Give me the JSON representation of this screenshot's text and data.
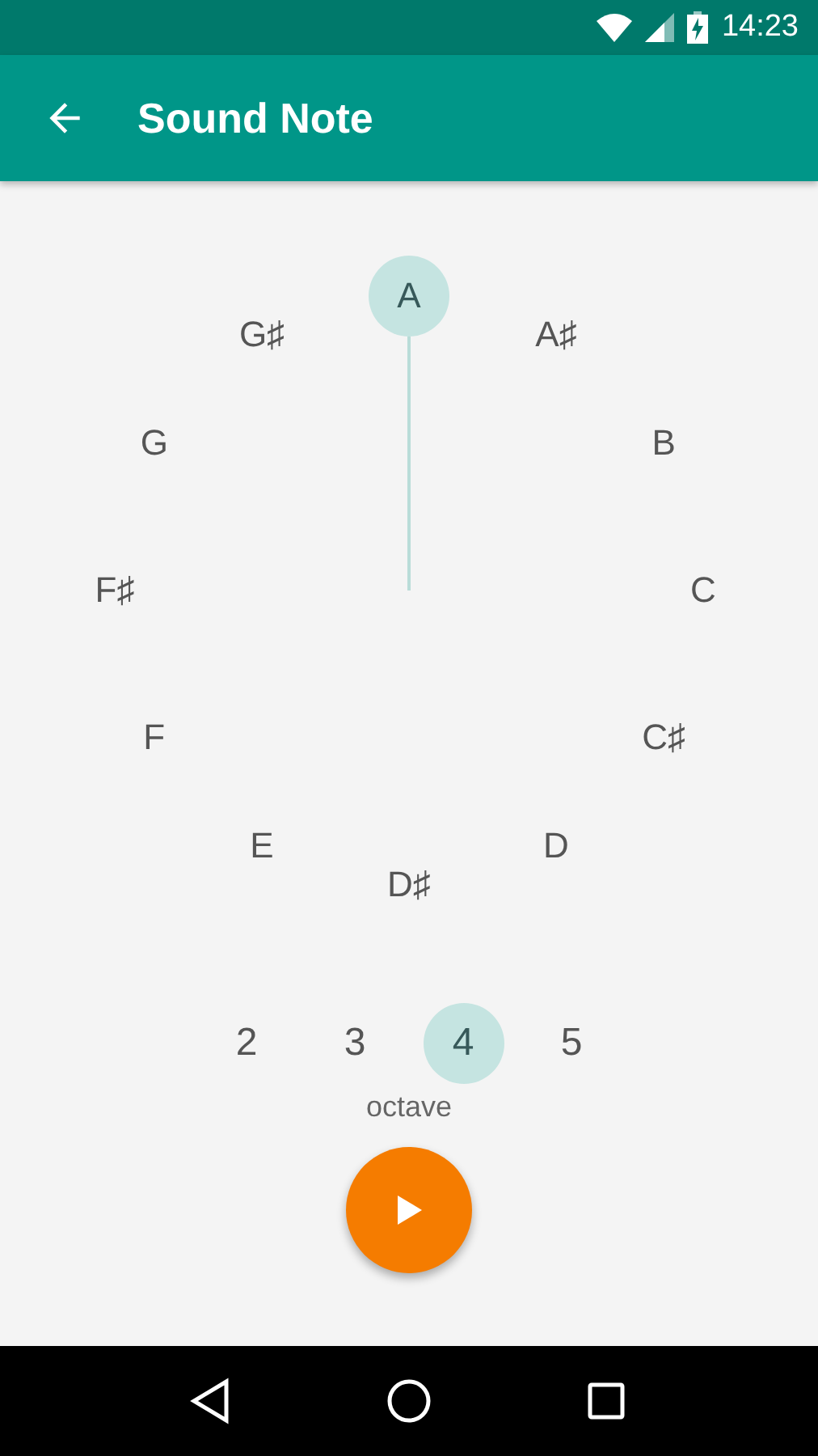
{
  "status_bar": {
    "time": "14:23"
  },
  "app_bar": {
    "title": "Sound Note"
  },
  "notes": [
    {
      "label": "A",
      "selected": true
    },
    {
      "label": "A♯",
      "selected": false
    },
    {
      "label": "B",
      "selected": false
    },
    {
      "label": "C",
      "selected": false
    },
    {
      "label": "C♯",
      "selected": false
    },
    {
      "label": "D",
      "selected": false
    },
    {
      "label": "D♯",
      "selected": false
    },
    {
      "label": "E",
      "selected": false
    },
    {
      "label": "F",
      "selected": false
    },
    {
      "label": "F♯",
      "selected": false
    },
    {
      "label": "G",
      "selected": false
    },
    {
      "label": "G♯",
      "selected": false
    }
  ],
  "octaves": [
    {
      "label": "2",
      "selected": false
    },
    {
      "label": "3",
      "selected": false
    },
    {
      "label": "4",
      "selected": true
    },
    {
      "label": "5",
      "selected": false
    }
  ],
  "octave_label": "octave"
}
